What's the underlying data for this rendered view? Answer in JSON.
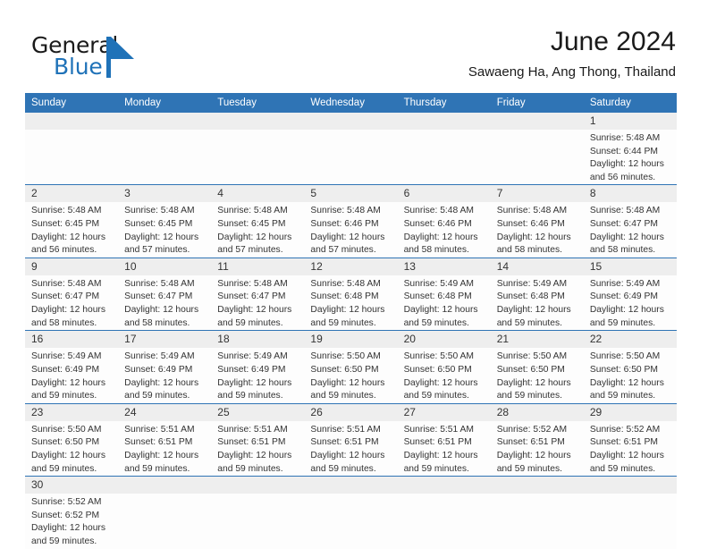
{
  "brand": {
    "name_part1": "General",
    "name_part2": "Blue",
    "mark_icon": "triangle-logo-icon"
  },
  "header": {
    "month_title": "June 2024",
    "location": "Sawaeng Ha, Ang Thong, Thailand"
  },
  "colors": {
    "header_blue": "#2f74b5",
    "brand_blue": "#1f72b8",
    "daynum_band": "#eeeeee",
    "cell_bg": "#fdfdfd",
    "text": "#333333"
  },
  "calendar": {
    "weekday_headers": [
      "Sunday",
      "Monday",
      "Tuesday",
      "Wednesday",
      "Thursday",
      "Friday",
      "Saturday"
    ],
    "weeks": [
      [
        {
          "day": "",
          "empty": true,
          "lines": []
        },
        {
          "day": "",
          "empty": true,
          "lines": []
        },
        {
          "day": "",
          "empty": true,
          "lines": []
        },
        {
          "day": "",
          "empty": true,
          "lines": []
        },
        {
          "day": "",
          "empty": true,
          "lines": []
        },
        {
          "day": "",
          "empty": true,
          "lines": []
        },
        {
          "day": "1",
          "empty": false,
          "lines": [
            "Sunrise: 5:48 AM",
            "Sunset: 6:44 PM",
            "Daylight: 12 hours",
            "and 56 minutes."
          ]
        }
      ],
      [
        {
          "day": "2",
          "empty": false,
          "lines": [
            "Sunrise: 5:48 AM",
            "Sunset: 6:45 PM",
            "Daylight: 12 hours",
            "and 56 minutes."
          ]
        },
        {
          "day": "3",
          "empty": false,
          "lines": [
            "Sunrise: 5:48 AM",
            "Sunset: 6:45 PM",
            "Daylight: 12 hours",
            "and 57 minutes."
          ]
        },
        {
          "day": "4",
          "empty": false,
          "lines": [
            "Sunrise: 5:48 AM",
            "Sunset: 6:45 PM",
            "Daylight: 12 hours",
            "and 57 minutes."
          ]
        },
        {
          "day": "5",
          "empty": false,
          "lines": [
            "Sunrise: 5:48 AM",
            "Sunset: 6:46 PM",
            "Daylight: 12 hours",
            "and 57 minutes."
          ]
        },
        {
          "day": "6",
          "empty": false,
          "lines": [
            "Sunrise: 5:48 AM",
            "Sunset: 6:46 PM",
            "Daylight: 12 hours",
            "and 58 minutes."
          ]
        },
        {
          "day": "7",
          "empty": false,
          "lines": [
            "Sunrise: 5:48 AM",
            "Sunset: 6:46 PM",
            "Daylight: 12 hours",
            "and 58 minutes."
          ]
        },
        {
          "day": "8",
          "empty": false,
          "lines": [
            "Sunrise: 5:48 AM",
            "Sunset: 6:47 PM",
            "Daylight: 12 hours",
            "and 58 minutes."
          ]
        }
      ],
      [
        {
          "day": "9",
          "empty": false,
          "lines": [
            "Sunrise: 5:48 AM",
            "Sunset: 6:47 PM",
            "Daylight: 12 hours",
            "and 58 minutes."
          ]
        },
        {
          "day": "10",
          "empty": false,
          "lines": [
            "Sunrise: 5:48 AM",
            "Sunset: 6:47 PM",
            "Daylight: 12 hours",
            "and 58 minutes."
          ]
        },
        {
          "day": "11",
          "empty": false,
          "lines": [
            "Sunrise: 5:48 AM",
            "Sunset: 6:47 PM",
            "Daylight: 12 hours",
            "and 59 minutes."
          ]
        },
        {
          "day": "12",
          "empty": false,
          "lines": [
            "Sunrise: 5:48 AM",
            "Sunset: 6:48 PM",
            "Daylight: 12 hours",
            "and 59 minutes."
          ]
        },
        {
          "day": "13",
          "empty": false,
          "lines": [
            "Sunrise: 5:49 AM",
            "Sunset: 6:48 PM",
            "Daylight: 12 hours",
            "and 59 minutes."
          ]
        },
        {
          "day": "14",
          "empty": false,
          "lines": [
            "Sunrise: 5:49 AM",
            "Sunset: 6:48 PM",
            "Daylight: 12 hours",
            "and 59 minutes."
          ]
        },
        {
          "day": "15",
          "empty": false,
          "lines": [
            "Sunrise: 5:49 AM",
            "Sunset: 6:49 PM",
            "Daylight: 12 hours",
            "and 59 minutes."
          ]
        }
      ],
      [
        {
          "day": "16",
          "empty": false,
          "lines": [
            "Sunrise: 5:49 AM",
            "Sunset: 6:49 PM",
            "Daylight: 12 hours",
            "and 59 minutes."
          ]
        },
        {
          "day": "17",
          "empty": false,
          "lines": [
            "Sunrise: 5:49 AM",
            "Sunset: 6:49 PM",
            "Daylight: 12 hours",
            "and 59 minutes."
          ]
        },
        {
          "day": "18",
          "empty": false,
          "lines": [
            "Sunrise: 5:49 AM",
            "Sunset: 6:49 PM",
            "Daylight: 12 hours",
            "and 59 minutes."
          ]
        },
        {
          "day": "19",
          "empty": false,
          "lines": [
            "Sunrise: 5:50 AM",
            "Sunset: 6:50 PM",
            "Daylight: 12 hours",
            "and 59 minutes."
          ]
        },
        {
          "day": "20",
          "empty": false,
          "lines": [
            "Sunrise: 5:50 AM",
            "Sunset: 6:50 PM",
            "Daylight: 12 hours",
            "and 59 minutes."
          ]
        },
        {
          "day": "21",
          "empty": false,
          "lines": [
            "Sunrise: 5:50 AM",
            "Sunset: 6:50 PM",
            "Daylight: 12 hours",
            "and 59 minutes."
          ]
        },
        {
          "day": "22",
          "empty": false,
          "lines": [
            "Sunrise: 5:50 AM",
            "Sunset: 6:50 PM",
            "Daylight: 12 hours",
            "and 59 minutes."
          ]
        }
      ],
      [
        {
          "day": "23",
          "empty": false,
          "lines": [
            "Sunrise: 5:50 AM",
            "Sunset: 6:50 PM",
            "Daylight: 12 hours",
            "and 59 minutes."
          ]
        },
        {
          "day": "24",
          "empty": false,
          "lines": [
            "Sunrise: 5:51 AM",
            "Sunset: 6:51 PM",
            "Daylight: 12 hours",
            "and 59 minutes."
          ]
        },
        {
          "day": "25",
          "empty": false,
          "lines": [
            "Sunrise: 5:51 AM",
            "Sunset: 6:51 PM",
            "Daylight: 12 hours",
            "and 59 minutes."
          ]
        },
        {
          "day": "26",
          "empty": false,
          "lines": [
            "Sunrise: 5:51 AM",
            "Sunset: 6:51 PM",
            "Daylight: 12 hours",
            "and 59 minutes."
          ]
        },
        {
          "day": "27",
          "empty": false,
          "lines": [
            "Sunrise: 5:51 AM",
            "Sunset: 6:51 PM",
            "Daylight: 12 hours",
            "and 59 minutes."
          ]
        },
        {
          "day": "28",
          "empty": false,
          "lines": [
            "Sunrise: 5:52 AM",
            "Sunset: 6:51 PM",
            "Daylight: 12 hours",
            "and 59 minutes."
          ]
        },
        {
          "day": "29",
          "empty": false,
          "lines": [
            "Sunrise: 5:52 AM",
            "Sunset: 6:51 PM",
            "Daylight: 12 hours",
            "and 59 minutes."
          ]
        }
      ],
      [
        {
          "day": "30",
          "empty": false,
          "lines": [
            "Sunrise: 5:52 AM",
            "Sunset: 6:52 PM",
            "Daylight: 12 hours",
            "and 59 minutes."
          ]
        },
        {
          "day": "",
          "empty": true,
          "lines": []
        },
        {
          "day": "",
          "empty": true,
          "lines": []
        },
        {
          "day": "",
          "empty": true,
          "lines": []
        },
        {
          "day": "",
          "empty": true,
          "lines": []
        },
        {
          "day": "",
          "empty": true,
          "lines": []
        },
        {
          "day": "",
          "empty": true,
          "lines": []
        }
      ]
    ]
  }
}
